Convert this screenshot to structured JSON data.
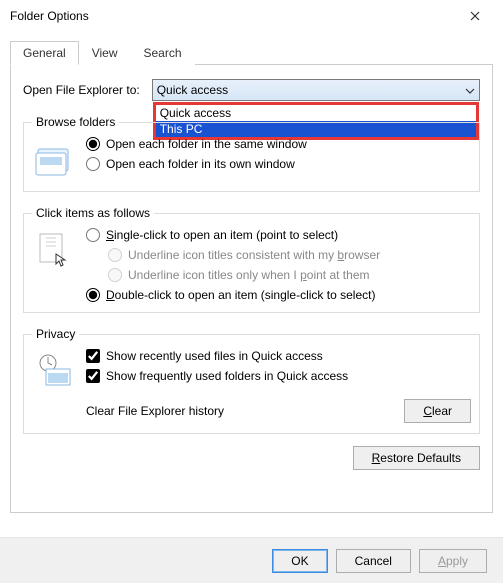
{
  "title": "Folder Options",
  "tabs": {
    "general": "General",
    "view": "View",
    "search": "Search"
  },
  "openExplorer": {
    "label": "Open File Explorer to:",
    "value": "Quick access",
    "option1": "Quick access",
    "option2": "This PC"
  },
  "browse": {
    "legend": "Browse folders",
    "same": "Open each folder in the same window",
    "own": "Open each folder in its own window"
  },
  "click": {
    "legend": "Click items as follows",
    "single_a": "S",
    "single_b": "ingle-click to open an item (point to select)",
    "u1_a": "Underline icon titles consistent with my ",
    "u1_b": "b",
    "u1_c": "rowser",
    "u2_a": "Underline icon titles only when I ",
    "u2_b": "p",
    "u2_c": "oint at them",
    "double_a": "D",
    "double_b": "ouble-click to open an item (single-click to select)"
  },
  "privacy": {
    "legend": "Privacy",
    "recent": "Show recently used files in Quick access",
    "frequent": "Show frequently used folders in Quick access",
    "clearLabel": "Clear File Explorer history",
    "clear_a": "C",
    "clear_b": "lear"
  },
  "restore_a": "R",
  "restore_b": "estore Defaults",
  "buttons": {
    "ok": "OK",
    "cancel": "Cancel",
    "apply_a": "A",
    "apply_b": "pply"
  }
}
